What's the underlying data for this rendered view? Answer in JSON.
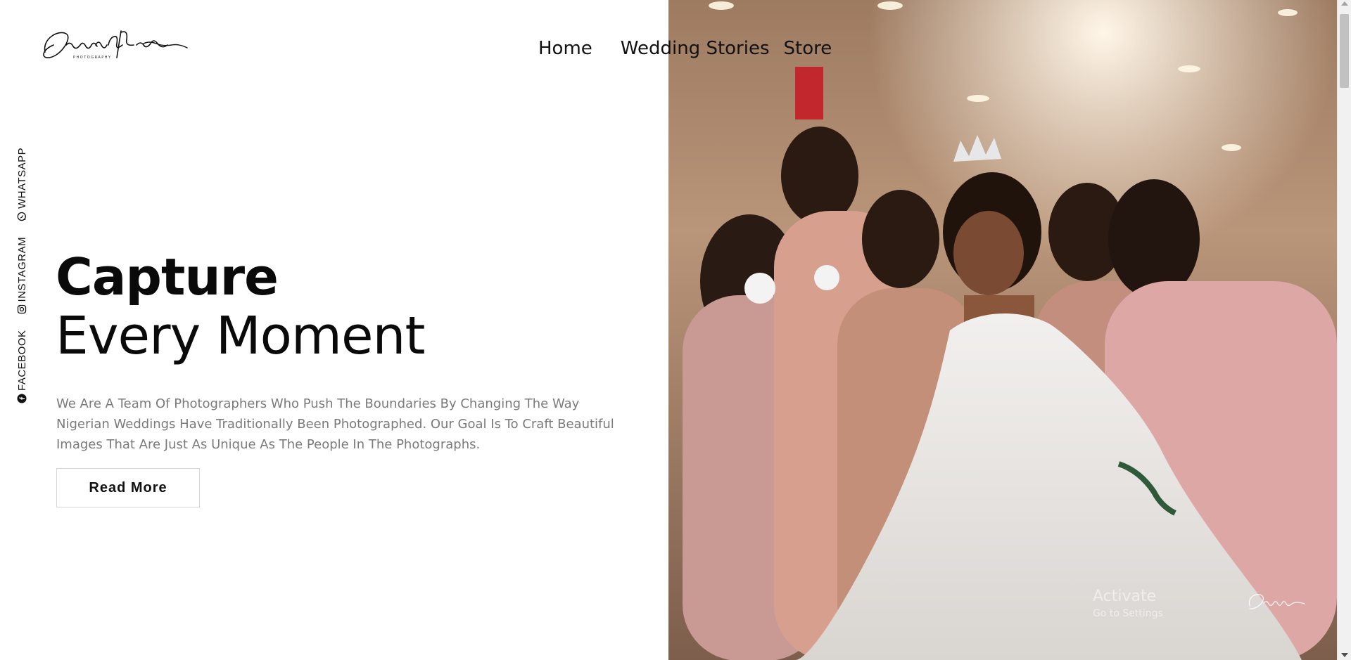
{
  "brand": {
    "logo_text": "Damanis Media",
    "logo_sub": "PHOTOGRAPHY"
  },
  "nav": {
    "items": [
      {
        "label": "Home"
      },
      {
        "label": "Wedding Stories"
      },
      {
        "label": "Store"
      }
    ]
  },
  "social": {
    "items": [
      {
        "label": "FACEBOOK",
        "icon": "facebook-icon"
      },
      {
        "label": "INSTAGRAM",
        "icon": "instagram-icon"
      },
      {
        "label": "WHATSAPP",
        "icon": "whatsapp-icon"
      }
    ]
  },
  "hero": {
    "title_line1": "Capture",
    "title_line2": "Every Moment",
    "description": "We Are A Team Of Photographers Who Push The Boundaries By Changing The Way Nigerian Weddings Have Traditionally Been Photographed. Our Goal Is To Craft Beautiful Images That Are Just As Unique As The People In The Photographs.",
    "cta_label": "Read More"
  },
  "overlay": {
    "activate_line1": "Activate",
    "activate_line2": "Go to Settings"
  }
}
